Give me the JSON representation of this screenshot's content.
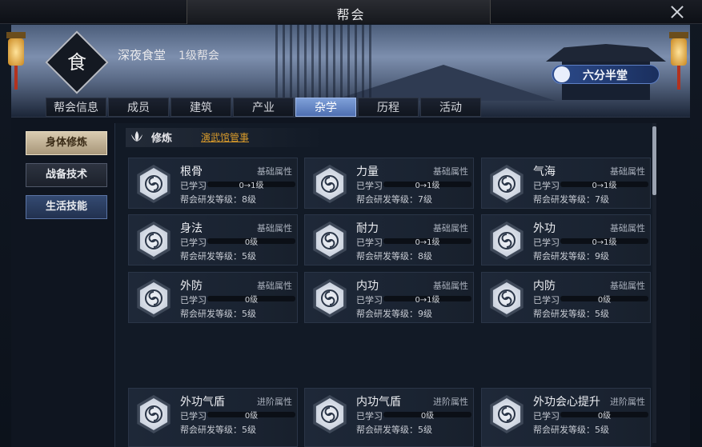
{
  "window": {
    "title": "帮会"
  },
  "guild": {
    "emblem": "食",
    "name": "深夜食堂",
    "level": "1级帮会",
    "location": "六分半堂"
  },
  "tabs": [
    {
      "label": "帮会信息"
    },
    {
      "label": "成员"
    },
    {
      "label": "建筑"
    },
    {
      "label": "产业"
    },
    {
      "label": "杂学"
    },
    {
      "label": "历程"
    },
    {
      "label": "活动"
    }
  ],
  "active_tab": "杂学",
  "subnav": [
    {
      "label": "身体修炼"
    },
    {
      "label": "战备技术"
    },
    {
      "label": "生活技能"
    }
  ],
  "section": {
    "title": "修炼",
    "link": "演武馆管事"
  },
  "skills": [
    {
      "name": "根骨",
      "kind": "基础属性",
      "learned_label": "已学习",
      "progress": "0→1级",
      "research": "帮会研发等级：8级"
    },
    {
      "name": "力量",
      "kind": "基础属性",
      "learned_label": "已学习",
      "progress": "0→1级",
      "research": "帮会研发等级：7级"
    },
    {
      "name": "气海",
      "kind": "基础属性",
      "learned_label": "已学习",
      "progress": "0→1级",
      "research": "帮会研发等级：7级"
    },
    {
      "name": "身法",
      "kind": "基础属性",
      "learned_label": "已学习",
      "progress": "0级",
      "research": "帮会研发等级：5级"
    },
    {
      "name": "耐力",
      "kind": "基础属性",
      "learned_label": "已学习",
      "progress": "0→1级",
      "research": "帮会研发等级：8级"
    },
    {
      "name": "外功",
      "kind": "基础属性",
      "learned_label": "已学习",
      "progress": "0→1级",
      "research": "帮会研发等级：9级"
    },
    {
      "name": "外防",
      "kind": "基础属性",
      "learned_label": "已学习",
      "progress": "0级",
      "research": "帮会研发等级：5级"
    },
    {
      "name": "内功",
      "kind": "基础属性",
      "learned_label": "已学习",
      "progress": "0→1级",
      "research": "帮会研发等级：9级"
    },
    {
      "name": "内防",
      "kind": "基础属性",
      "learned_label": "已学习",
      "progress": "0级",
      "research": "帮会研发等级：5级"
    },
    {
      "name": "外功气盾",
      "kind": "进阶属性",
      "learned_label": "已学习",
      "progress": "0级",
      "research": "帮会研发等级：5级"
    },
    {
      "name": "内功气盾",
      "kind": "进阶属性",
      "learned_label": "已学习",
      "progress": "0级",
      "research": "帮会研发等级：5级"
    },
    {
      "name": "外功会心提升",
      "kind": "进阶属性",
      "learned_label": "已学习",
      "progress": "0级",
      "research": "帮会研发等级：5级"
    }
  ]
}
